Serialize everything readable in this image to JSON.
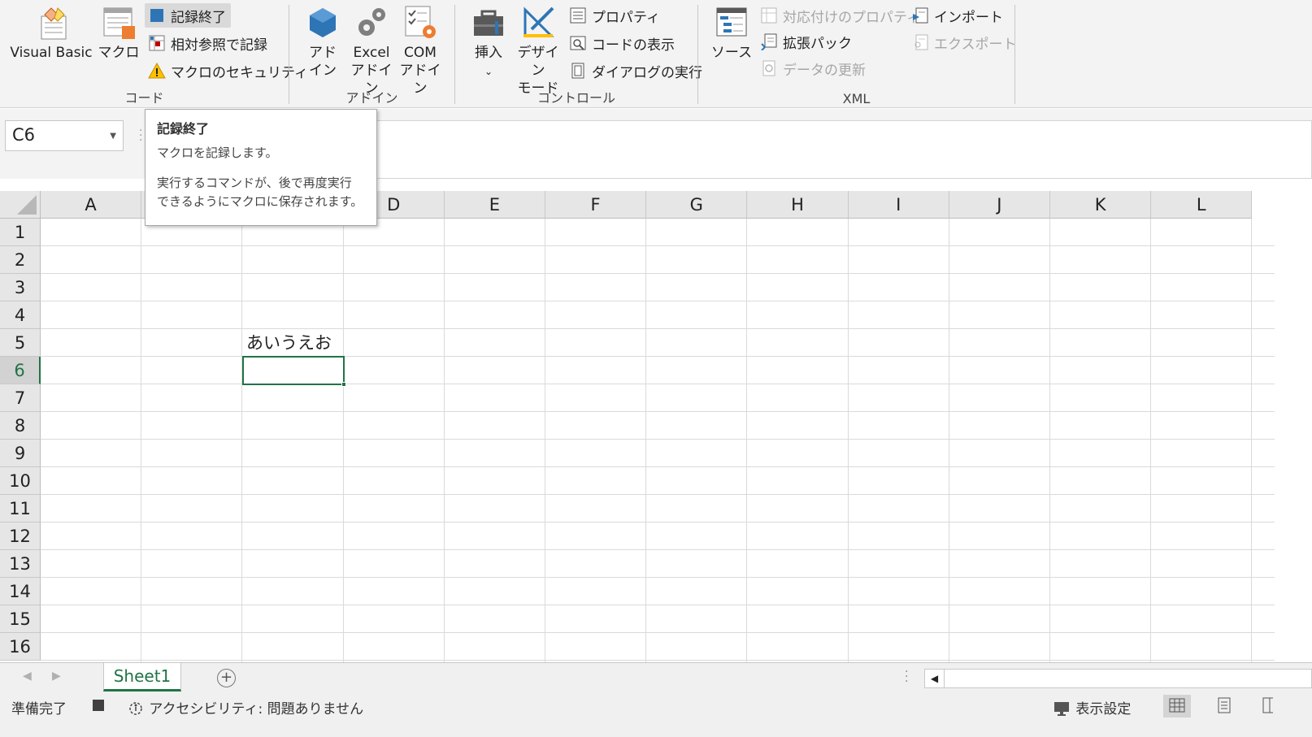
{
  "ribbon": {
    "code_group": {
      "label": "コード",
      "visual_basic": "Visual Basic",
      "macro": "マクロ",
      "stop_recording": "記録終了",
      "relative_ref": "相対参照で記録",
      "macro_security": "マクロのセキュリティ"
    },
    "addin_group": {
      "label": "アドイン",
      "addin_line1": "アド",
      "addin_line2": "イン",
      "excel_addin_line1": "Excel",
      "excel_addin_line2": "アドイン",
      "com_addin_line1": "COM",
      "com_addin_line2": "アドイン"
    },
    "controls_group": {
      "label": "コントロール",
      "insert": "挿入",
      "design_mode_line1": "デザイン",
      "design_mode_line2": "モード",
      "properties": "プロパティ",
      "view_code": "コードの表示",
      "run_dialog": "ダイアログの実行"
    },
    "xml_group": {
      "label": "XML",
      "source": "ソース",
      "map_properties": "対応付けのプロパティ",
      "expansion_packs": "拡張パック",
      "refresh_data": "データの更新",
      "import": "インポート",
      "export": "エクスポート"
    }
  },
  "namebox": {
    "value": "C6"
  },
  "tooltip": {
    "title": "記録終了",
    "line1": "マクロを記録します。",
    "line2": "実行するコマンドが、後で再度実行",
    "line3": "できるようにマクロに保存されます。"
  },
  "grid": {
    "columns": [
      "A",
      "B",
      "C",
      "D",
      "E",
      "F",
      "G",
      "H",
      "I",
      "J",
      "K",
      "L"
    ],
    "rows": [
      "1",
      "2",
      "3",
      "4",
      "5",
      "6",
      "7",
      "8",
      "9",
      "10",
      "11",
      "12",
      "13",
      "14",
      "15",
      "16"
    ],
    "cell_C5": "あいうえお",
    "active_cell": "C6"
  },
  "sheets": {
    "active": "Sheet1",
    "add_symbol": "+"
  },
  "status": {
    "ready": "準備完了",
    "accessibility": "アクセシビリティ: 問題ありません",
    "display_settings": "表示設定"
  },
  "colors": {
    "accent": "#217346",
    "ribbon_bg": "#f3f3f3",
    "macro_blue": "#2e75b6"
  }
}
